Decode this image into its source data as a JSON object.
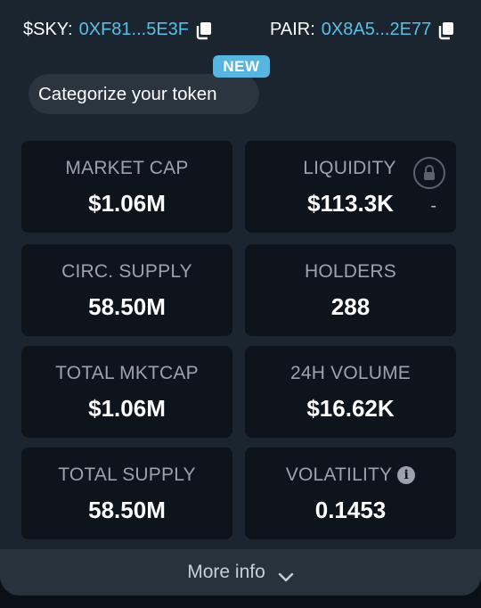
{
  "header": {
    "token": {
      "label": "$SKY:",
      "address": "0XF81...5E3F"
    },
    "pair": {
      "label": "PAIR:",
      "address": "0X8A5...2E77"
    }
  },
  "categorize": {
    "label": "Categorize your token",
    "badge": "NEW"
  },
  "stats": [
    {
      "label": "MARKET CAP",
      "value": "$1.06M"
    },
    {
      "label": "LIQUIDITY",
      "value": "$113.3K",
      "extra": "-"
    },
    {
      "label": "CIRC. SUPPLY",
      "value": "58.50M"
    },
    {
      "label": "HOLDERS",
      "value": "288"
    },
    {
      "label": "TOTAL MKTCAP",
      "value": "$1.06M"
    },
    {
      "label": "24H VOLUME",
      "value": "$16.62K"
    },
    {
      "label": "TOTAL SUPPLY",
      "value": "58.50M"
    },
    {
      "label": "VOLATILITY",
      "value": "0.1453",
      "info_icon": "i"
    }
  ],
  "footer": {
    "more_info_label": "More info"
  },
  "colors": {
    "accent": "#58c0e8",
    "badge": "#56b6e0",
    "panel": "#1b252f",
    "card": "#0e141c"
  }
}
